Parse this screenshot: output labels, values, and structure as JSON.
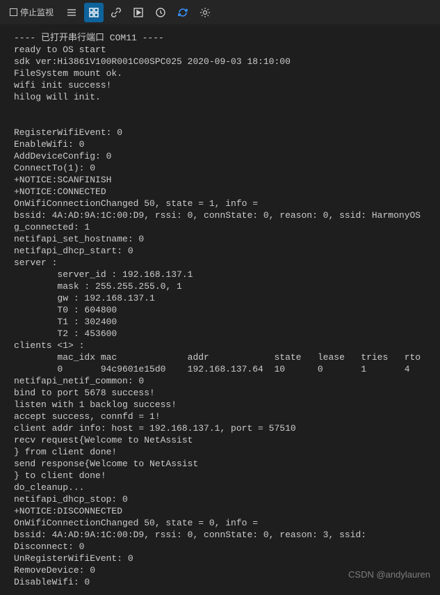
{
  "toolbar": {
    "stop_label": "停止监视"
  },
  "terminal_lines": [
    "---- 已打开串行端口 COM11 ----",
    "ready to OS start",
    "sdk ver:Hi3861V100R001C00SPC025 2020-09-03 18:10:00",
    "FileSystem mount ok.",
    "wifi init success!",
    "hilog will init.",
    "",
    "",
    "RegisterWifiEvent: 0",
    "EnableWifi: 0",
    "AddDeviceConfig: 0",
    "ConnectTo(1): 0",
    "+NOTICE:SCANFINISH",
    "+NOTICE:CONNECTED",
    "OnWifiConnectionChanged 50, state = 1, info = ",
    "bssid: 4A:AD:9A:1C:00:D9, rssi: 0, connState: 0, reason: 0, ssid: HarmonyOS",
    "g_connected: 1",
    "netifapi_set_hostname: 0",
    "netifapi_dhcp_start: 0",
    "server :",
    "        server_id : 192.168.137.1",
    "        mask : 255.255.255.0, 1",
    "        gw : 192.168.137.1",
    "        T0 : 604800",
    "        T1 : 302400",
    "        T2 : 453600",
    "clients <1> :",
    "        mac_idx mac             addr            state   lease   tries   rto",
    "        0       94c9601e15d0    192.168.137.64  10      0       1       4",
    "netifapi_netif_common: 0",
    "bind to port 5678 success!",
    "listen with 1 backlog success!",
    "accept success, connfd = 1!",
    "client addr info: host = 192.168.137.1, port = 57510",
    "recv request{Welcome to NetAssist",
    "} from client done!",
    "send response{Welcome to NetAssist",
    "} to client done!",
    "do_cleanup...",
    "netifapi_dhcp_stop: 0",
    "+NOTICE:DISCONNECTED",
    "OnWifiConnectionChanged 50, state = 0, info = ",
    "bssid: 4A:AD:9A:1C:00:D9, rssi: 0, connState: 0, reason: 3, ssid: ",
    "Disconnect: 0",
    "UnRegisterWifiEvent: 0",
    "RemoveDevice: 0",
    "DisableWifi: 0"
  ],
  "watermark": "CSDN @andylauren"
}
